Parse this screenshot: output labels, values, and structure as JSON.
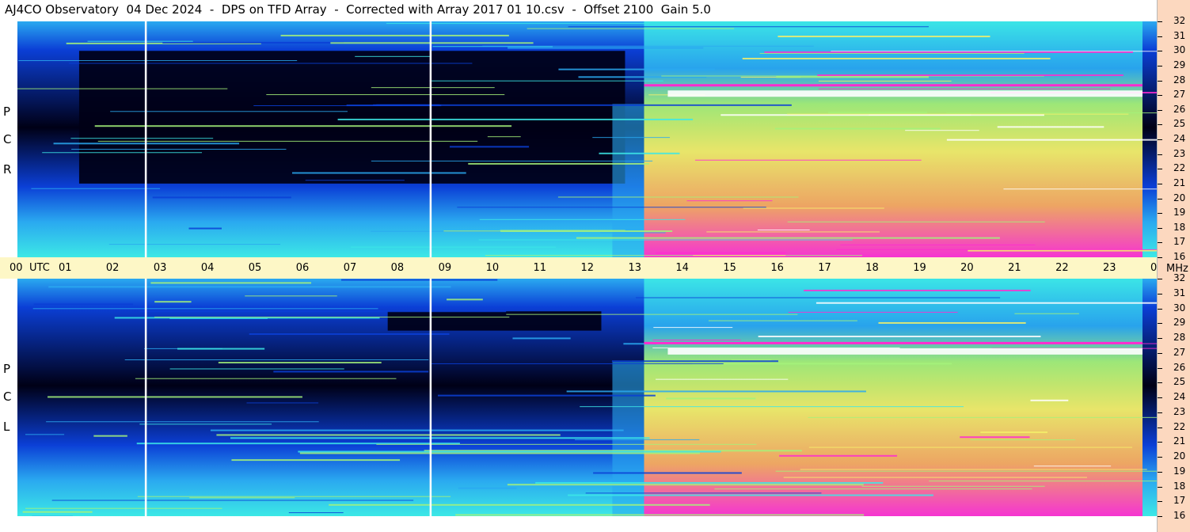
{
  "title": "AJ4CO Observatory  04 Dec 2024  -  DPS on TFD Array  -  Corrected with Array 2017 01 10.csv  -  Offset 2100  Gain 5.0",
  "labels": {
    "top_polarization": [
      "R",
      "C",
      "P"
    ],
    "bottom_polarization": [
      "L",
      "C",
      "P"
    ],
    "utc_unit": "UTC",
    "mhz_unit": "MHz"
  },
  "colors": {
    "quiet": "#000016",
    "low": "#0b3fd6",
    "mid": "#2aa9f0",
    "high_cyan": "#3ce8e6",
    "green": "#a5f27a",
    "yellow": "#f4f06a",
    "orange": "#f8a85c",
    "magenta": "#ff2bd0",
    "saturated": "#ffffff",
    "axis_bg_time": "#fdf7c6",
    "axis_bg_freq": "#fcd8bf"
  },
  "chart_data": [
    {
      "type": "heatmap",
      "name": "RCP",
      "title": "AJ4CO Observatory  04 Dec 2024  -  DPS on TFD Array  -  Corrected with Array 2017 01 10.csv  -  Offset 2100  Gain 5.0",
      "x_tick_labels": [
        "00",
        "01",
        "02",
        "03",
        "04",
        "05",
        "06",
        "07",
        "08",
        "09",
        "10",
        "11",
        "12",
        "13",
        "14",
        "15",
        "16",
        "17",
        "18",
        "19",
        "20",
        "21",
        "22",
        "23",
        "00"
      ],
      "xlabel": "UTC",
      "xlim": [
        0,
        24
      ],
      "y_tick_labels": [
        "16",
        "17",
        "18",
        "19",
        "20",
        "21",
        "22",
        "23",
        "24",
        "25",
        "26",
        "27",
        "28",
        "29",
        "30",
        "31",
        "32"
      ],
      "ylabel": "MHz",
      "ylim": [
        16,
        32
      ],
      "grid": false,
      "features": {
        "daytime_noise_rise_utc": 13.2,
        "daytime_noise_end_utc": 23.7,
        "spike_lines_utc": [
          2.7,
          8.7
        ],
        "strong_band_mhz": 27.1,
        "quiet_region_mhz": [
          21,
          30
        ],
        "quiet_region_utc": [
          1.3,
          12.8
        ]
      }
    },
    {
      "type": "heatmap",
      "name": "LCP",
      "x_tick_labels": [
        "00",
        "01",
        "02",
        "03",
        "04",
        "05",
        "06",
        "07",
        "08",
        "09",
        "10",
        "11",
        "12",
        "13",
        "14",
        "15",
        "16",
        "17",
        "18",
        "19",
        "20",
        "21",
        "22",
        "23",
        "00"
      ],
      "xlabel": "UTC",
      "xlim": [
        0,
        24
      ],
      "y_tick_labels": [
        "16",
        "17",
        "18",
        "19",
        "20",
        "21",
        "22",
        "23",
        "24",
        "25",
        "26",
        "27",
        "28",
        "29",
        "30",
        "31",
        "32"
      ],
      "ylabel": "MHz",
      "ylim": [
        16,
        32
      ],
      "grid": false,
      "features": {
        "daytime_noise_rise_utc": 13.2,
        "daytime_noise_end_utc": 23.7,
        "spike_lines_utc": [
          2.7,
          8.7
        ],
        "strong_band_mhz": 27.1,
        "quiet_region_mhz": [
          28.5,
          29.8
        ],
        "quiet_region_utc": [
          7.8,
          12.3
        ]
      }
    }
  ]
}
